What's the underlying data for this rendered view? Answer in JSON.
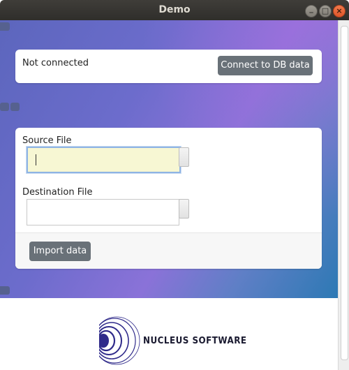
{
  "window": {
    "title": "Demo"
  },
  "connection": {
    "status": "Not connected",
    "connect_label": "Connect to DB data"
  },
  "form": {
    "source_label": "Source File",
    "source_value": "",
    "destination_label": "Destination File",
    "destination_value": "",
    "import_label": "Import data"
  },
  "logo": {
    "text": "NUCLEUS SOFTWARE"
  },
  "colors": {
    "button": "#697178",
    "focused_field": "#f7f7d3",
    "title_bar": "#33322f"
  },
  "icons": [
    "minimize-icon",
    "maximize-icon",
    "close-icon"
  ]
}
